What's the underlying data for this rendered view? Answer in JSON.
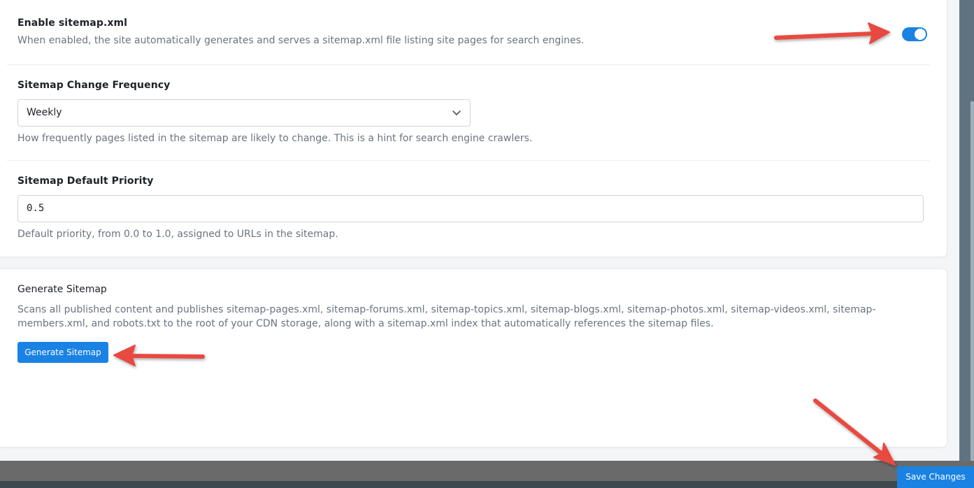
{
  "sitemap_enabled": {
    "title": "Enable sitemap.xml",
    "description": "When enabled, the site automatically generates and serves a sitemap.xml file listing site pages for search engines.",
    "toggle_on": true
  },
  "change_frequency": {
    "title": "Sitemap Change Frequency",
    "selected": "Weekly",
    "description": "How frequently pages listed in the sitemap are likely to change. This is a hint for search engine crawlers."
  },
  "default_priority": {
    "title": "Sitemap Default Priority",
    "value": "0.5",
    "description": "Default priority, from 0.0 to 1.0, assigned to URLs in the sitemap."
  },
  "generate": {
    "title": "Generate Sitemap",
    "description": "Scans all published content and publishes sitemap-pages.xml, sitemap-forums.xml, sitemap-topics.xml, sitemap-blogs.xml, sitemap-photos.xml, sitemap-videos.xml, sitemap-members.xml, and robots.txt to the root of your CDN storage, along with a sitemap.xml index that automatically references the sitemap files.",
    "button_label": "Generate Sitemap"
  },
  "footer": {
    "save_label": "Save Changes"
  },
  "colors": {
    "accent": "#1a82e2",
    "annotation_arrow": "#e8483f"
  },
  "icons": {
    "select_chevron": "chevron-down-icon"
  }
}
